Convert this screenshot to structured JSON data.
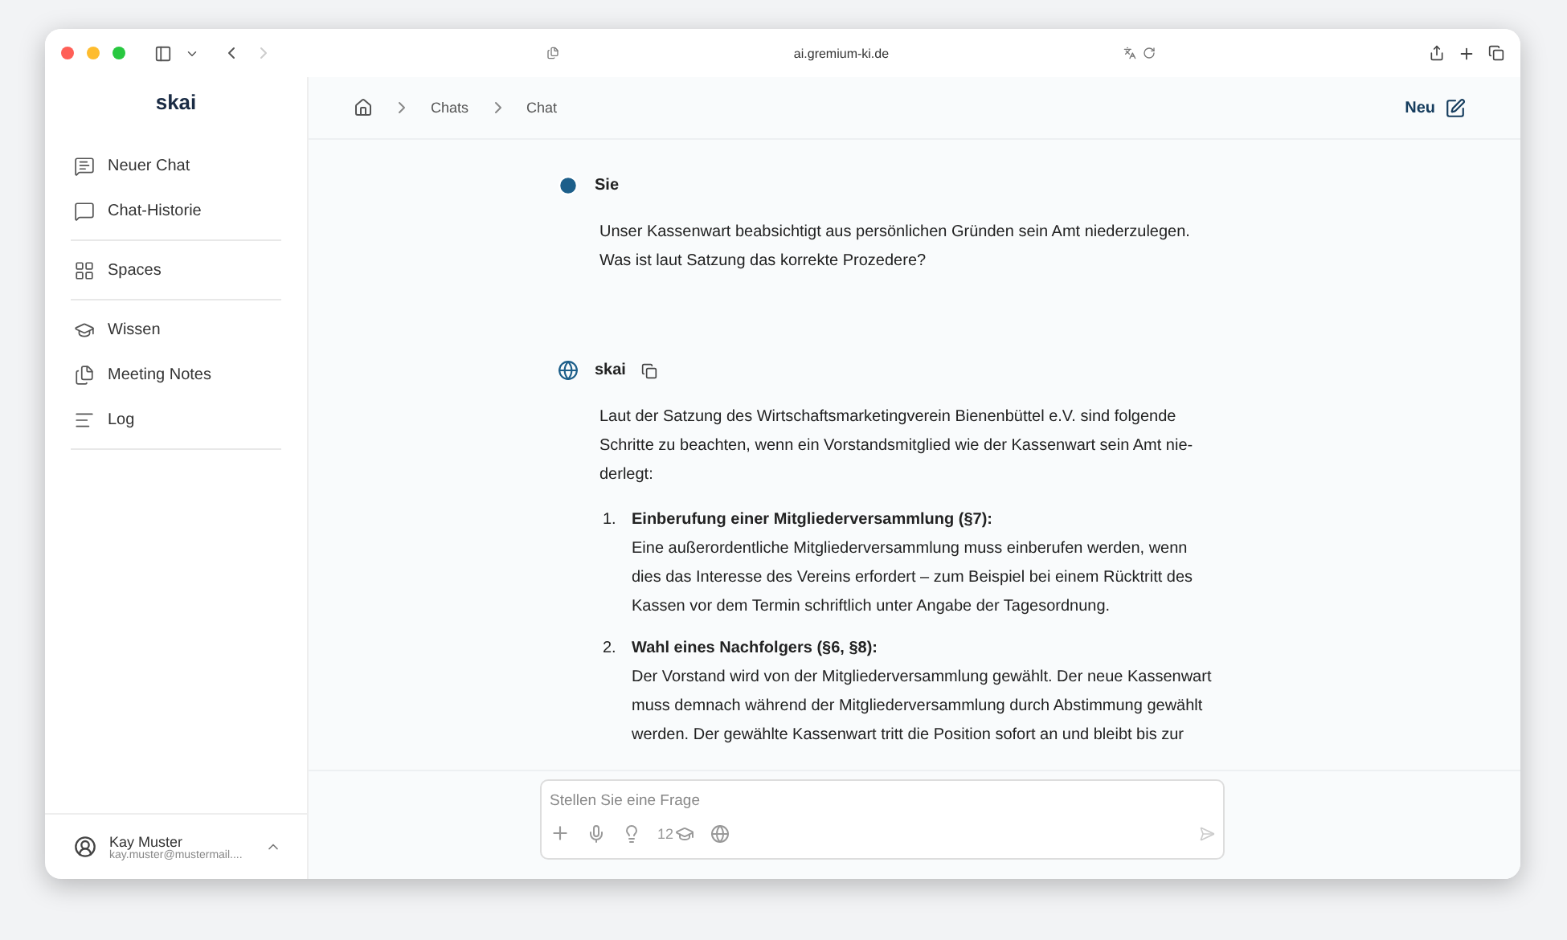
{
  "browser": {
    "url": "ai.gremium-ki.de",
    "back_disabled": false,
    "forward_disabled": true
  },
  "sidebar": {
    "logo": "skai",
    "groups": [
      [
        {
          "label": "Neuer Chat"
        },
        {
          "label": "Chat-Historie"
        }
      ],
      [
        {
          "label": "Spaces"
        }
      ],
      [
        {
          "label": "Wissen"
        },
        {
          "label": "Meeting Notes"
        },
        {
          "label": "Log"
        }
      ]
    ],
    "user": {
      "name": "Kay Muster",
      "email": "kay.muster@mustermail...."
    }
  },
  "header": {
    "breadcrumbs": [
      "Chats",
      "Chat"
    ],
    "new_button": "Neu"
  },
  "messages": [
    {
      "kind": "user",
      "author": "Sie",
      "paragraphs": [
        {
          "kind": "text",
          "lines": [
            "Unser Kassenwart beabsichtigt aus persönlichen Gründen sein Amt niederzulegen.",
            "Was ist laut Satzung das korrekte Prozedere?"
          ]
        }
      ]
    },
    {
      "kind": "assistant",
      "author": "skai",
      "paragraphs": [
        {
          "kind": "text",
          "lines": [
            "Laut der Satzung des Wirtschaftsmarketingverein Bienenbüttel e.V. sind folgende",
            "Schritte zu beachten, wenn ein Vorstandsmitglied wie der Kassenwart sein Amt nie-",
            "derlegt:"
          ]
        },
        {
          "kind": "item",
          "number": "1.",
          "title": "Einberufung einer Mitgliederversammlung (§7):",
          "lines": [
            "Eine außerordentliche Mitgliederversammlung muss einberufen werden, wenn",
            "dies das Interesse des Vereins erfordert – zum Beispiel bei einem Rücktritt des",
            "Kassen vor dem Termin schriftlich unter Angabe der Tagesordnung."
          ]
        },
        {
          "kind": "item",
          "number": "2.",
          "title": "Wahl eines Nachfolgers (§6, §8):",
          "lines": [
            "Der Vorstand wird von der Mitgliederversammlung gewählt. Der neue Kassenwart",
            "muss demnach während der Mitgliederversammlung durch Abstimmung gewählt",
            "werden. Der gewählte Kassenwart tritt die Position sofort an und bleibt bis zur"
          ]
        }
      ]
    }
  ],
  "composer": {
    "placeholder": "Stellen Sie eine Frage",
    "knowledge_count": "12"
  }
}
